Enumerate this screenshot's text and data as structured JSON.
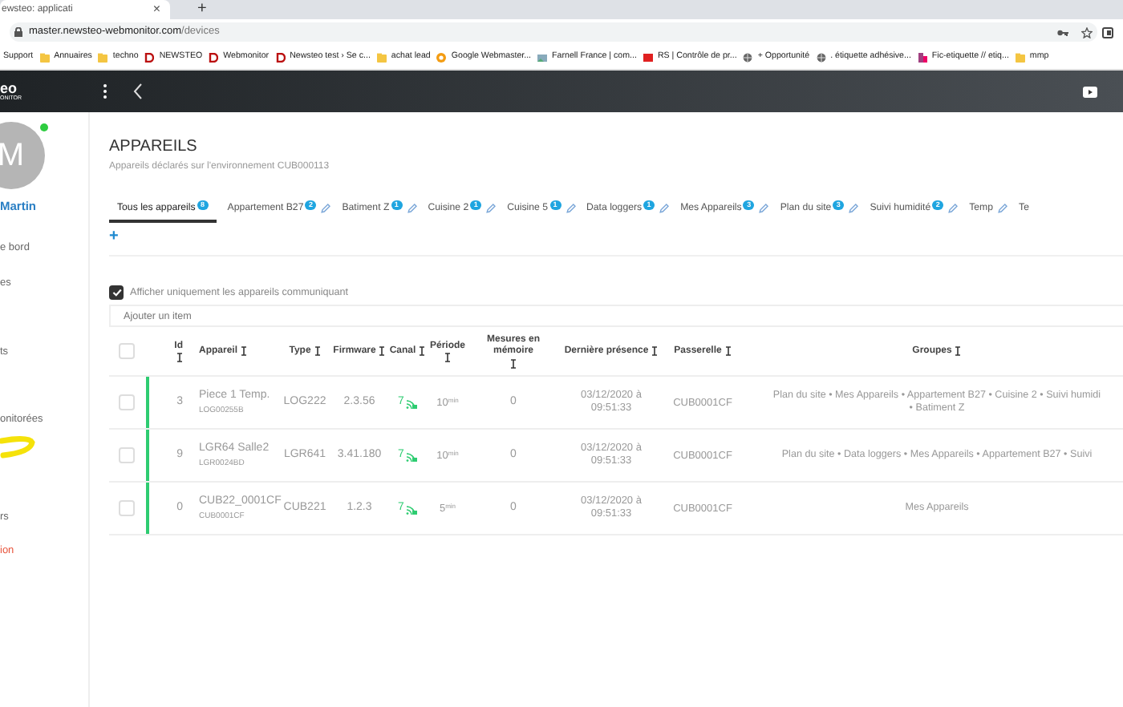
{
  "browser": {
    "tab_title": "ewsteo: applicati",
    "tab_close": "×",
    "new_tab": "+",
    "url_host": "master.newsteo-webmonitor.com",
    "url_path": "/devices",
    "bookmarks": [
      {
        "label": "Support",
        "kind": "none"
      },
      {
        "label": "Annuaires",
        "kind": "folder"
      },
      {
        "label": "techno",
        "kind": "folder"
      },
      {
        "label": "NEWSTEO",
        "kind": "logo"
      },
      {
        "label": "Webmonitor",
        "kind": "logo"
      },
      {
        "label": "Newsteo test › Se c...",
        "kind": "logo"
      },
      {
        "label": "achat lead",
        "kind": "folder"
      },
      {
        "label": "Google Webmaster...",
        "kind": "google"
      },
      {
        "label": "Farnell France | com...",
        "kind": "image"
      },
      {
        "label": "RS | Contrôle de pr...",
        "kind": "rs"
      },
      {
        "label": "+ Opportunité",
        "kind": "globe"
      },
      {
        "label": ". étiquette adhésive...",
        "kind": "globe"
      },
      {
        "label": "Fic-etiquette // etiq...",
        "kind": "tag"
      },
      {
        "label": "mmp",
        "kind": "folder"
      }
    ]
  },
  "app_header": {
    "logo_top": "eo",
    "logo_bottom": "ONITOR"
  },
  "sidebar": {
    "avatar_letter": "M",
    "online": true,
    "user_name": "Martin",
    "items": [
      {
        "label": "e bord",
        "kind": "link"
      },
      {
        "label": "es",
        "kind": "link"
      },
      {
        "label": "ts",
        "kind": "link"
      },
      {
        "label": "onitorées",
        "kind": "link"
      },
      {
        "label": "rs",
        "kind": "link"
      },
      {
        "label": "ion",
        "kind": "danger"
      }
    ]
  },
  "page": {
    "title": "APPAREILS",
    "subtitle": "Appareils déclarés sur l'environnement CUB000113"
  },
  "tabs": [
    {
      "label": "Tous les appareils",
      "count": "8",
      "editable": false,
      "selected": true
    },
    {
      "label": "Appartement B27",
      "count": "2",
      "editable": true,
      "selected": false
    },
    {
      "label": "Batiment Z",
      "count": "1",
      "editable": true,
      "selected": false
    },
    {
      "label": "Cuisine 2",
      "count": "1",
      "editable": true,
      "selected": false
    },
    {
      "label": "Cuisine 5",
      "count": "1",
      "editable": true,
      "selected": false
    },
    {
      "label": "Data loggers",
      "count": "1",
      "editable": true,
      "selected": false
    },
    {
      "label": "Mes Appareils",
      "count": "3",
      "editable": true,
      "selected": false
    },
    {
      "label": "Plan du site",
      "count": "3",
      "editable": true,
      "selected": false
    },
    {
      "label": "Suivi humidité",
      "count": "2",
      "editable": true,
      "selected": false
    },
    {
      "label": "Temp",
      "editable": true,
      "selected": false
    },
    {
      "label": "Te",
      "editable": false,
      "selected": false
    }
  ],
  "add_tab": "+",
  "filter": {
    "label": "Afficher uniquement les appareils communiquant",
    "checked": true
  },
  "search": {
    "placeholder": "Ajouter un item"
  },
  "table": {
    "select_all": {
      "checked": false
    },
    "columns": [
      {
        "label": "Id"
      },
      {
        "label": "Appareil"
      },
      {
        "label": "Type"
      },
      {
        "label": "Firmware"
      },
      {
        "label": "Canal"
      },
      {
        "label": "Période"
      },
      {
        "label": "Mesures en mémoire"
      },
      {
        "label": "Dernière présence"
      },
      {
        "label": "Passerelle"
      },
      {
        "label": "Groupes"
      }
    ],
    "rows": [
      {
        "checked": false,
        "id": "3",
        "name": "Piece 1 Temp.",
        "serial": "LOG00255B",
        "type": "LOG222",
        "firmware": "2.3.56",
        "channel": "7",
        "period": "10$^{min}$",
        "memory": "0",
        "last_seen": "03/12/2020 à 09:51:33",
        "gateway": "CUB0001CF",
        "groups": [
          "Plan du site • Mes Appareils • Appartement B27 • Cuisine 2 • Suivi humidi",
          "• Batiment Z"
        ]
      },
      {
        "checked": false,
        "id": "9",
        "name": "LGR64 Salle2",
        "serial": "LGR0024BD",
        "type": "LGR641",
        "firmware": "3.41.180",
        "channel": "7",
        "period": "10$^{min}$",
        "memory": "0",
        "last_seen": "03/12/2020 à 09:51:33",
        "gateway": "CUB0001CF",
        "groups": [
          "Plan du site • Data loggers • Mes Appareils • Appartement B27 • Suivi"
        ]
      },
      {
        "checked": false,
        "id": "0",
        "name": "CUB22_0001CF",
        "serial": "CUB0001CF",
        "type": "CUB221",
        "firmware": "1.2.3",
        "channel": "7",
        "period": "5$^{min}$",
        "memory": "0",
        "last_seen": "03/12/2020 à 09:51:33",
        "gateway": "CUB0001CF",
        "groups": [
          "Mes Appareils"
        ]
      }
    ]
  }
}
